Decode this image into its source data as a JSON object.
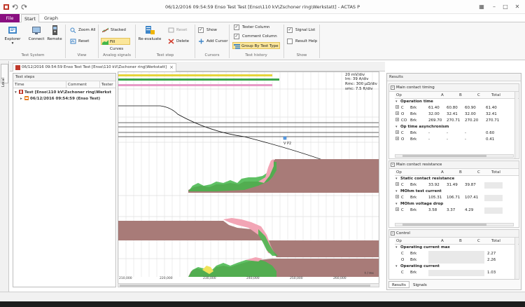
{
  "window": {
    "title": "06/12/2016 09:54:59 Enso Test Test [Enso\\110 kV\\Zschoner ring\\Werkstatt] - ACTAS P"
  },
  "ribbon_tabs": [
    "File",
    "Start",
    "Graph"
  ],
  "ribbon": {
    "test_system": {
      "group_label": "Test System",
      "explorer": "Explorer",
      "connect": "Connect",
      "remote": "Remote"
    },
    "view": {
      "group_label": "View",
      "zoom_all": "Zoom All",
      "reset": "Reset"
    },
    "analog_signals": {
      "group_label": "Analog signals",
      "stacked": "Stacked",
      "fill_curves": "Fill Curves"
    },
    "test_step": {
      "group_label": "Test step",
      "reevaluate": "Re-evaluate",
      "reset": "Reset",
      "delete": "Delete"
    },
    "cursors": {
      "group_label": "Cursors",
      "show": "Show",
      "add_cursor": "Add Cursor"
    },
    "test_history": {
      "group_label": "Test history",
      "tester_column": "Tester Column",
      "comment_column": "Comment Column",
      "group_by_test_type": "Group By Test Type"
    },
    "show": {
      "group_label": "Show",
      "signal_list": "Signal List",
      "result_help": "Result Help"
    }
  },
  "left_strip": {
    "tab_label": "Local"
  },
  "document_tab": {
    "label": "06/12/2016 09:54:59 Enso Test Test [Enso\\110 kV\\Zschoner ring\\Werkstatt]"
  },
  "test_steps": {
    "header": "Test steps",
    "columns": [
      "Time",
      "Comment",
      "Tester"
    ],
    "tree": [
      {
        "label": "Test [Enso\\110 kV\\Zschoner ring\\Werkst"
      },
      {
        "label": "06/12/2016 09:54:59 (Enso Test)"
      }
    ]
  },
  "plot": {
    "scale_info": [
      "20 mV/div",
      "Irn: 39 A/div",
      "Rmc: 300 µΩ/div",
      "smc: 7.5 ft/div"
    ],
    "cursor_label": "V P2",
    "t_label": "t / ms",
    "time_ticks": [
      "210,000",
      "220,000",
      "230,000",
      "240,000",
      "250,000",
      "260,000"
    ]
  },
  "results": {
    "header": "Results",
    "main_timing": {
      "title": "Main contact timing",
      "columns": [
        "Op",
        "A",
        "B",
        "C",
        "Total"
      ],
      "operation_time": {
        "title": "Operation time",
        "rows": [
          {
            "op1": "C",
            "op2": "Brk",
            "a": "61.40",
            "b": "60.80",
            "c": "60.90",
            "total": "61.40"
          },
          {
            "op1": "O",
            "op2": "Brk",
            "a": "32.00",
            "b": "32.41",
            "c": "32.00",
            "total": "32.41"
          },
          {
            "op1": "CO",
            "op2": "Brk",
            "a": "269.70",
            "b": "270.71",
            "c": "270.20",
            "total": "270.71"
          }
        ]
      },
      "asynchronism": {
        "title": "Op time asynchronism",
        "rows": [
          {
            "op1": "C",
            "op2": "Brk",
            "a": "-",
            "b": "-",
            "c": "-",
            "total": "0.60"
          },
          {
            "op1": "O",
            "op2": "Brk",
            "a": "-",
            "b": "-",
            "c": "-",
            "total": "0.41"
          }
        ]
      }
    },
    "main_resistance": {
      "title": "Main contact resistance",
      "columns": [
        "Op",
        "A",
        "B",
        "C",
        "Total"
      ],
      "static": {
        "title": "Static contact resistance",
        "rows": [
          {
            "op1": "C",
            "op2": "Brk",
            "a": "33.92",
            "b": "31.49",
            "c": "39.87",
            "total": ""
          }
        ]
      },
      "mohm_current": {
        "title": "MOhm test current",
        "rows": [
          {
            "op1": "C",
            "op2": "Brk",
            "a": "105.31",
            "b": "106.71",
            "c": "107.41",
            "total": ""
          }
        ]
      },
      "mohm_voltage": {
        "title": "MOhm voltage drop",
        "rows": [
          {
            "op1": "C",
            "op2": "Brk",
            "a": "3.58",
            "b": "3.37",
            "c": "4.29",
            "total": ""
          }
        ]
      }
    },
    "control": {
      "title": "Control",
      "columns": [
        "Op",
        "A",
        "B",
        "C",
        "Total"
      ],
      "max_current": {
        "title": "Operating current max",
        "rows": [
          {
            "op1": "C",
            "op2": "Brk",
            "total": "2.27"
          },
          {
            "op1": "O",
            "op2": "Brk",
            "total": "2.26"
          }
        ]
      },
      "current": {
        "title": "Operating current",
        "rows": [
          {
            "op1": "C",
            "op2": "Brk",
            "total": "1.03"
          }
        ]
      }
    },
    "bottom_tabs": [
      "Results",
      "Signals"
    ]
  },
  "colors": {
    "file_tab": "#8a0f80",
    "fill_brown": "#a87b78",
    "fill_green": "#43b649",
    "fill_pink": "#f2a5b5",
    "fill_yellow": "#f0e35a",
    "timing_yellow": "#e6d43a",
    "timing_green": "#3aa64a",
    "timing_pink": "#e79ac7"
  }
}
